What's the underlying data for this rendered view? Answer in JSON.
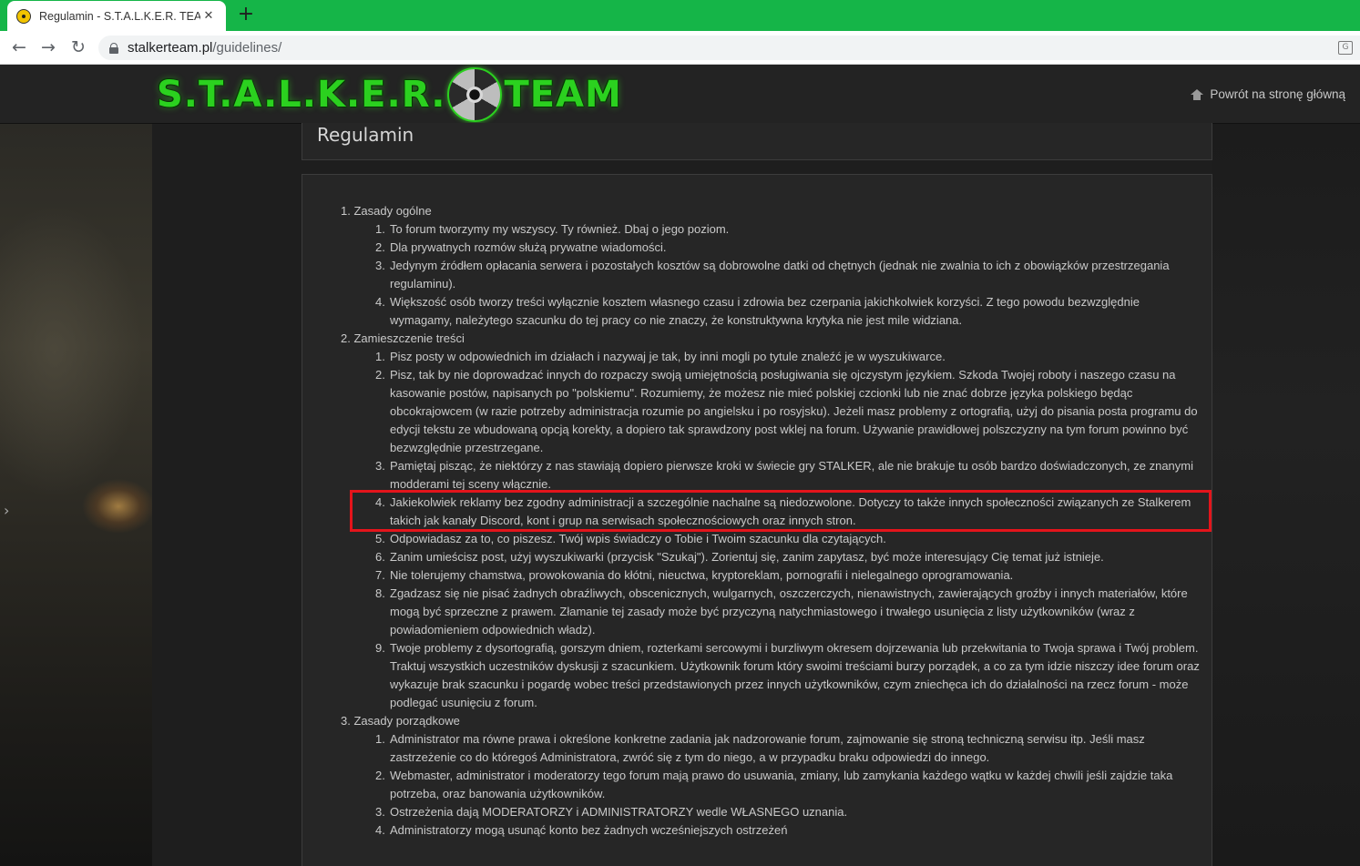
{
  "browser": {
    "tab_title": "Regulamin - S.T.A.L.K.E.R. TEAM",
    "tab_close": "✕",
    "new_tab": "+",
    "url_host": "stalkerteam.pl",
    "url_path": "/guidelines/",
    "back": "←",
    "forward": "→",
    "reload": "↻"
  },
  "site": {
    "logo_left": "S.T.A.L.K.E.R.",
    "logo_right": "TEAM",
    "home_link": "Powrót na stronę główną",
    "page_title": "Regulamin",
    "side_arrow": "›"
  },
  "rules": {
    "s1": {
      "num": "1.",
      "title": "Zasady ogólne",
      "items": [
        {
          "num": "1.",
          "text": "To forum tworzymy my wszyscy. Ty również. Dbaj o jego poziom."
        },
        {
          "num": "2.",
          "text": "Dla prywatnych rozmów służą prywatne wiadomości."
        },
        {
          "num": "3.",
          "text": "Jedynym źródłem opłacania serwera i pozostałych kosztów są dobrowolne datki od chętnych (jednak nie zwalnia to ich z obowiązków przestrzegania regulaminu)."
        },
        {
          "num": "4.",
          "text": "Większość osób tworzy treści wyłącznie kosztem własnego czasu i zdrowia bez czerpania jakichkolwiek korzyści. Z tego powodu bezwzględnie wymagamy, należytego szacunku do tej pracy co nie znaczy, że konstruktywna krytyka nie jest mile widziana."
        }
      ]
    },
    "s2": {
      "num": "2.",
      "title": "Zamieszczenie treści",
      "items": [
        {
          "num": "1.",
          "text": "Pisz posty w odpowiednich im działach i nazywaj je tak, by inni mogli po tytule znaleźć je w wyszukiwarce."
        },
        {
          "num": "2.",
          "text": "Pisz, tak by nie doprowadzać innych do rozpaczy swoją umiejętnością posługiwania się ojczystym językiem. Szkoda Twojej roboty i naszego czasu na kasowanie postów, napisanych po \"polskiemu\". Rozumiemy, że możesz nie mieć polskiej czcionki lub nie znać dobrze języka polskiego będąc obcokrajowcem (w razie potrzeby administracja rozumie po angielsku i po rosyjsku). Jeżeli masz problemy z ortografią, użyj do pisania posta programu do edycji tekstu ze wbudowaną opcją korekty, a dopiero tak sprawdzony post wklej na forum. Używanie prawidłowej polszczyzny na tym forum powinno być bezwzględnie przestrzegane."
        },
        {
          "num": "3.",
          "text": "Pamiętaj pisząc, że niektórzy z nas stawiają dopiero pierwsze kroki w świecie gry STALKER, ale nie brakuje tu osób bardzo doświadczonych, ze znanymi modderami tej sceny włącznie."
        },
        {
          "num": "4.",
          "text": "Jakiekolwiek reklamy bez zgodny administracji a szczególnie nachalne są niedozwolone. Dotyczy to także innych społeczności związanych ze Stalkerem takich jak kanały Discord, kont i grup na serwisach społecznościowych oraz innych stron."
        },
        {
          "num": "5.",
          "text": "Odpowiadasz za to, co piszesz. Twój wpis świadczy o Tobie i Twoim szacunku dla czytających."
        },
        {
          "num": "6.",
          "text": "Zanim umieścisz post, użyj wyszukiwarki (przycisk \"Szukaj\"). Zorientuj się, zanim zapytasz, być może interesujący Cię temat już istnieje."
        },
        {
          "num": "7.",
          "text": "Nie tolerujemy chamstwa, prowokowania do kłótni, nieuctwa, kryptoreklam, pornografii i nielegalnego oprogramowania."
        },
        {
          "num": "8.",
          "text": "Zgadzasz się nie pisać żadnych obraźliwych, obscenicznych, wulgarnych, oszczerczych, nienawistnych, zawierających groźby i innych materiałów, które mogą być sprzeczne z prawem. Złamanie tej zasady może być przyczyną natychmiastowego i trwałego usunięcia z listy użytkowników (wraz z powiadomieniem odpowiednich władz)."
        },
        {
          "num": "9.",
          "text": "Twoje problemy z dysortografią, gorszym dniem, rozterkami sercowymi i burzliwym okresem dojrzewania lub przekwitania to Twoja sprawa i Twój problem. Traktuj wszystkich uczestników dyskusji z szacunkiem. Użytkownik forum który swoimi treściami burzy porządek, a co za tym idzie niszczy idee forum oraz wykazuje brak szacunku i pogardę wobec treści przedstawionych przez innych użytkowników, czym zniechęca ich do działalności na rzecz forum - może podlegać usunięciu z forum."
        }
      ]
    },
    "s3": {
      "num": "3.",
      "title": "Zasady porządkowe",
      "items": [
        {
          "num": "1.",
          "text": "Administrator ma równe prawa i określone konkretne zadania jak nadzorowanie forum, zajmowanie się stroną techniczną serwisu itp. Jeśli masz zastrzeżenie co do któregoś Administratora, zwróć się z tym do niego, a w przypadku braku odpowiedzi do innego."
        },
        {
          "num": "2.",
          "text": "Webmaster, administrator i moderatorzy tego forum mają prawo do usuwania, zmiany, lub zamykania każdego wątku w każdej chwili jeśli zajdzie taka potrzeba, oraz banowania użytkowników."
        },
        {
          "num": "3.",
          "text": "Ostrzeżenia dają MODERATORZY i ADMINISTRATORZY wedle WŁASNEGO uznania."
        },
        {
          "num": "4.",
          "text": "Administratorzy mogą usunąć konto bez żadnych wcześniejszych ostrzeżeń"
        }
      ]
    }
  },
  "colors": {
    "tabbar": "#15b548",
    "logo_green": "#2bd11f",
    "highlight": "#e4141b"
  }
}
